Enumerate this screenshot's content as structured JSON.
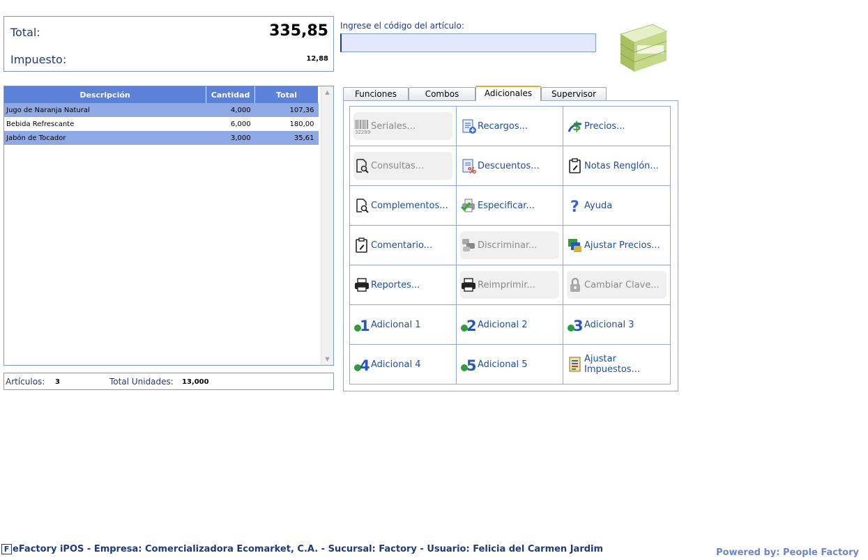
{
  "totals": {
    "total_label": "Total:",
    "total_value": "335,85",
    "tax_label": "Impuesto:",
    "tax_value": "12,88"
  },
  "article": {
    "label": "Ingrese el código del artículo:",
    "value": ""
  },
  "table": {
    "headers": [
      "Descripción",
      "Cantidad",
      "Total"
    ],
    "rows": [
      {
        "desc": "Jugo de Naranja Natural",
        "qty": "4,000",
        "total": "107,36"
      },
      {
        "desc": "Bebida Refrescante",
        "qty": "6,000",
        "total": "180,00"
      },
      {
        "desc": "Jabón de Tocador",
        "qty": "3,000",
        "total": "35,61"
      }
    ]
  },
  "summary": {
    "articles_label": "Artículos:",
    "articles_value": "3",
    "units_label": "Total Unidades:",
    "units_value": "13,000"
  },
  "tabs": [
    "Funciones",
    "Combos",
    "Adicionales",
    "Supervisor"
  ],
  "active_tab": "Adicionales",
  "buttons": [
    {
      "label": "Seriales...",
      "icon": "barcode-icon",
      "disabled": true
    },
    {
      "label": "Recargos...",
      "icon": "document-plus-icon",
      "disabled": false
    },
    {
      "label": "Precios...",
      "icon": "dollar-icon",
      "disabled": false
    },
    {
      "label": "Consultas...",
      "icon": "search-document-icon",
      "disabled": true
    },
    {
      "label": "Descuentos...",
      "icon": "document-percent-icon",
      "disabled": false
    },
    {
      "label": "Notas Renglón...",
      "icon": "clipboard-edit-icon",
      "disabled": false
    },
    {
      "label": "Complementos...",
      "icon": "search-document-icon",
      "disabled": false
    },
    {
      "label": "Especificar...",
      "icon": "printer-check-icon",
      "disabled": false
    },
    {
      "label": "Ayuda",
      "icon": "help-icon",
      "disabled": false
    },
    {
      "label": "Comentario...",
      "icon": "clipboard-edit-icon",
      "disabled": false
    },
    {
      "label": "Discriminar...",
      "icon": "split-icon",
      "disabled": true
    },
    {
      "label": "Ajustar Precios...",
      "icon": "adjust-price-icon",
      "disabled": false
    },
    {
      "label": "Reportes...",
      "icon": "printer-icon",
      "disabled": false
    },
    {
      "label": "Reimprimir...",
      "icon": "printer-icon",
      "disabled": true
    },
    {
      "label": "Cambiar Clave...",
      "icon": "lock-icon",
      "disabled": true
    },
    {
      "label": "Adicional 1",
      "icon": "number-1-icon",
      "disabled": false
    },
    {
      "label": "Adicional 2",
      "icon": "number-2-icon",
      "disabled": false
    },
    {
      "label": "Adicional 3",
      "icon": "number-3-icon",
      "disabled": false
    },
    {
      "label": "Adicional 4",
      "icon": "number-4-icon",
      "disabled": false
    },
    {
      "label": "Adicional 5",
      "icon": "number-5-icon",
      "disabled": false
    },
    {
      "label": "Ajustar Impuestos...",
      "icon": "tax-list-icon",
      "disabled": false
    }
  ],
  "status": {
    "logo": "F",
    "text": "eFactory iPOS - Empresa: Comercializadora Ecomarket, C.A. - Sucursal: Factory - Usuario: Felicia del Carmen Jardim",
    "powered": "Powered by: People Factory"
  },
  "colors": {
    "header_blue": "#5b82d6",
    "selected_row": "#8ea9e6",
    "text_blue": "#1f3a7a",
    "tab_accent": "#f0a830"
  }
}
